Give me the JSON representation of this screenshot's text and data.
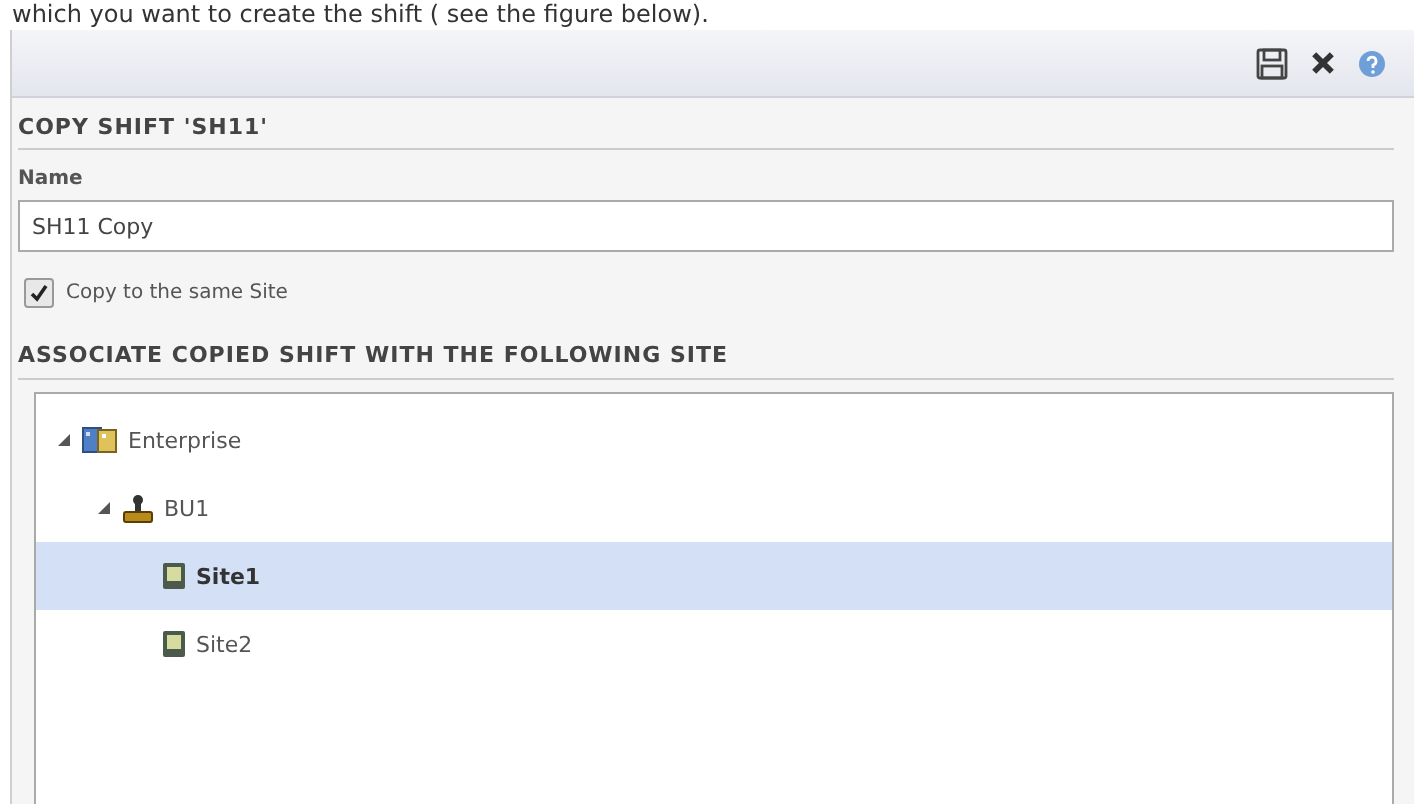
{
  "caption": "which you want to create the shift ( see the figure below).",
  "toolbar": {
    "buttons": [
      {
        "kind": "save"
      },
      {
        "kind": "close"
      },
      {
        "kind": "help"
      }
    ]
  },
  "title": "COPY SHIFT 'SH11'",
  "name_field": {
    "label": "Name",
    "value": "SH11 Copy"
  },
  "same_site": {
    "label": "Copy to the same Site",
    "checked": true
  },
  "section_title": "ASSOCIATE COPIED SHIFT WITH THE FOLLOWING SITE",
  "tree": [
    {
      "label": "Enterprise",
      "kind": "enterprise",
      "expanded": true,
      "selected": false,
      "children": [
        {
          "label": "BU1",
          "kind": "unit",
          "expanded": true,
          "selected": false,
          "children": [
            {
              "label": "Site1",
              "kind": "site",
              "selected": true
            },
            {
              "label": "Site2",
              "kind": "site",
              "selected": false
            }
          ]
        }
      ]
    }
  ]
}
